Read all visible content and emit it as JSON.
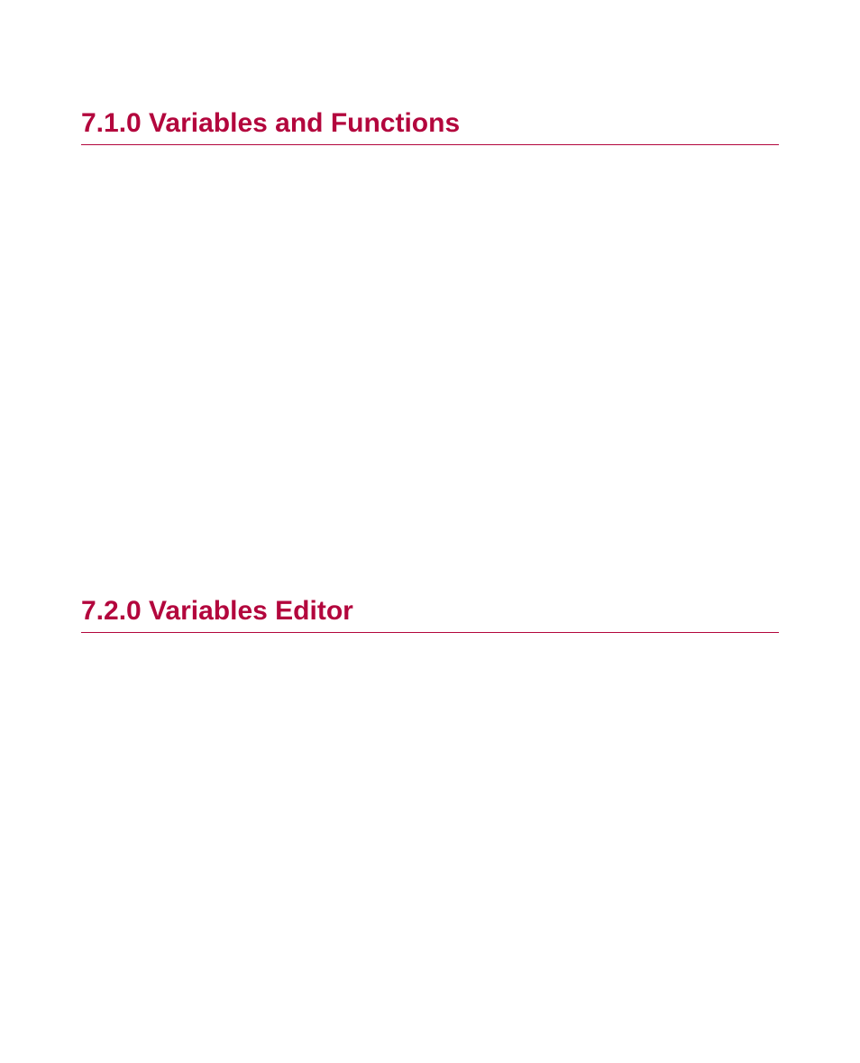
{
  "sections": [
    {
      "heading": "7.1.0 Variables and Functions"
    },
    {
      "heading": "7.2.0 Variables Editor"
    }
  ]
}
